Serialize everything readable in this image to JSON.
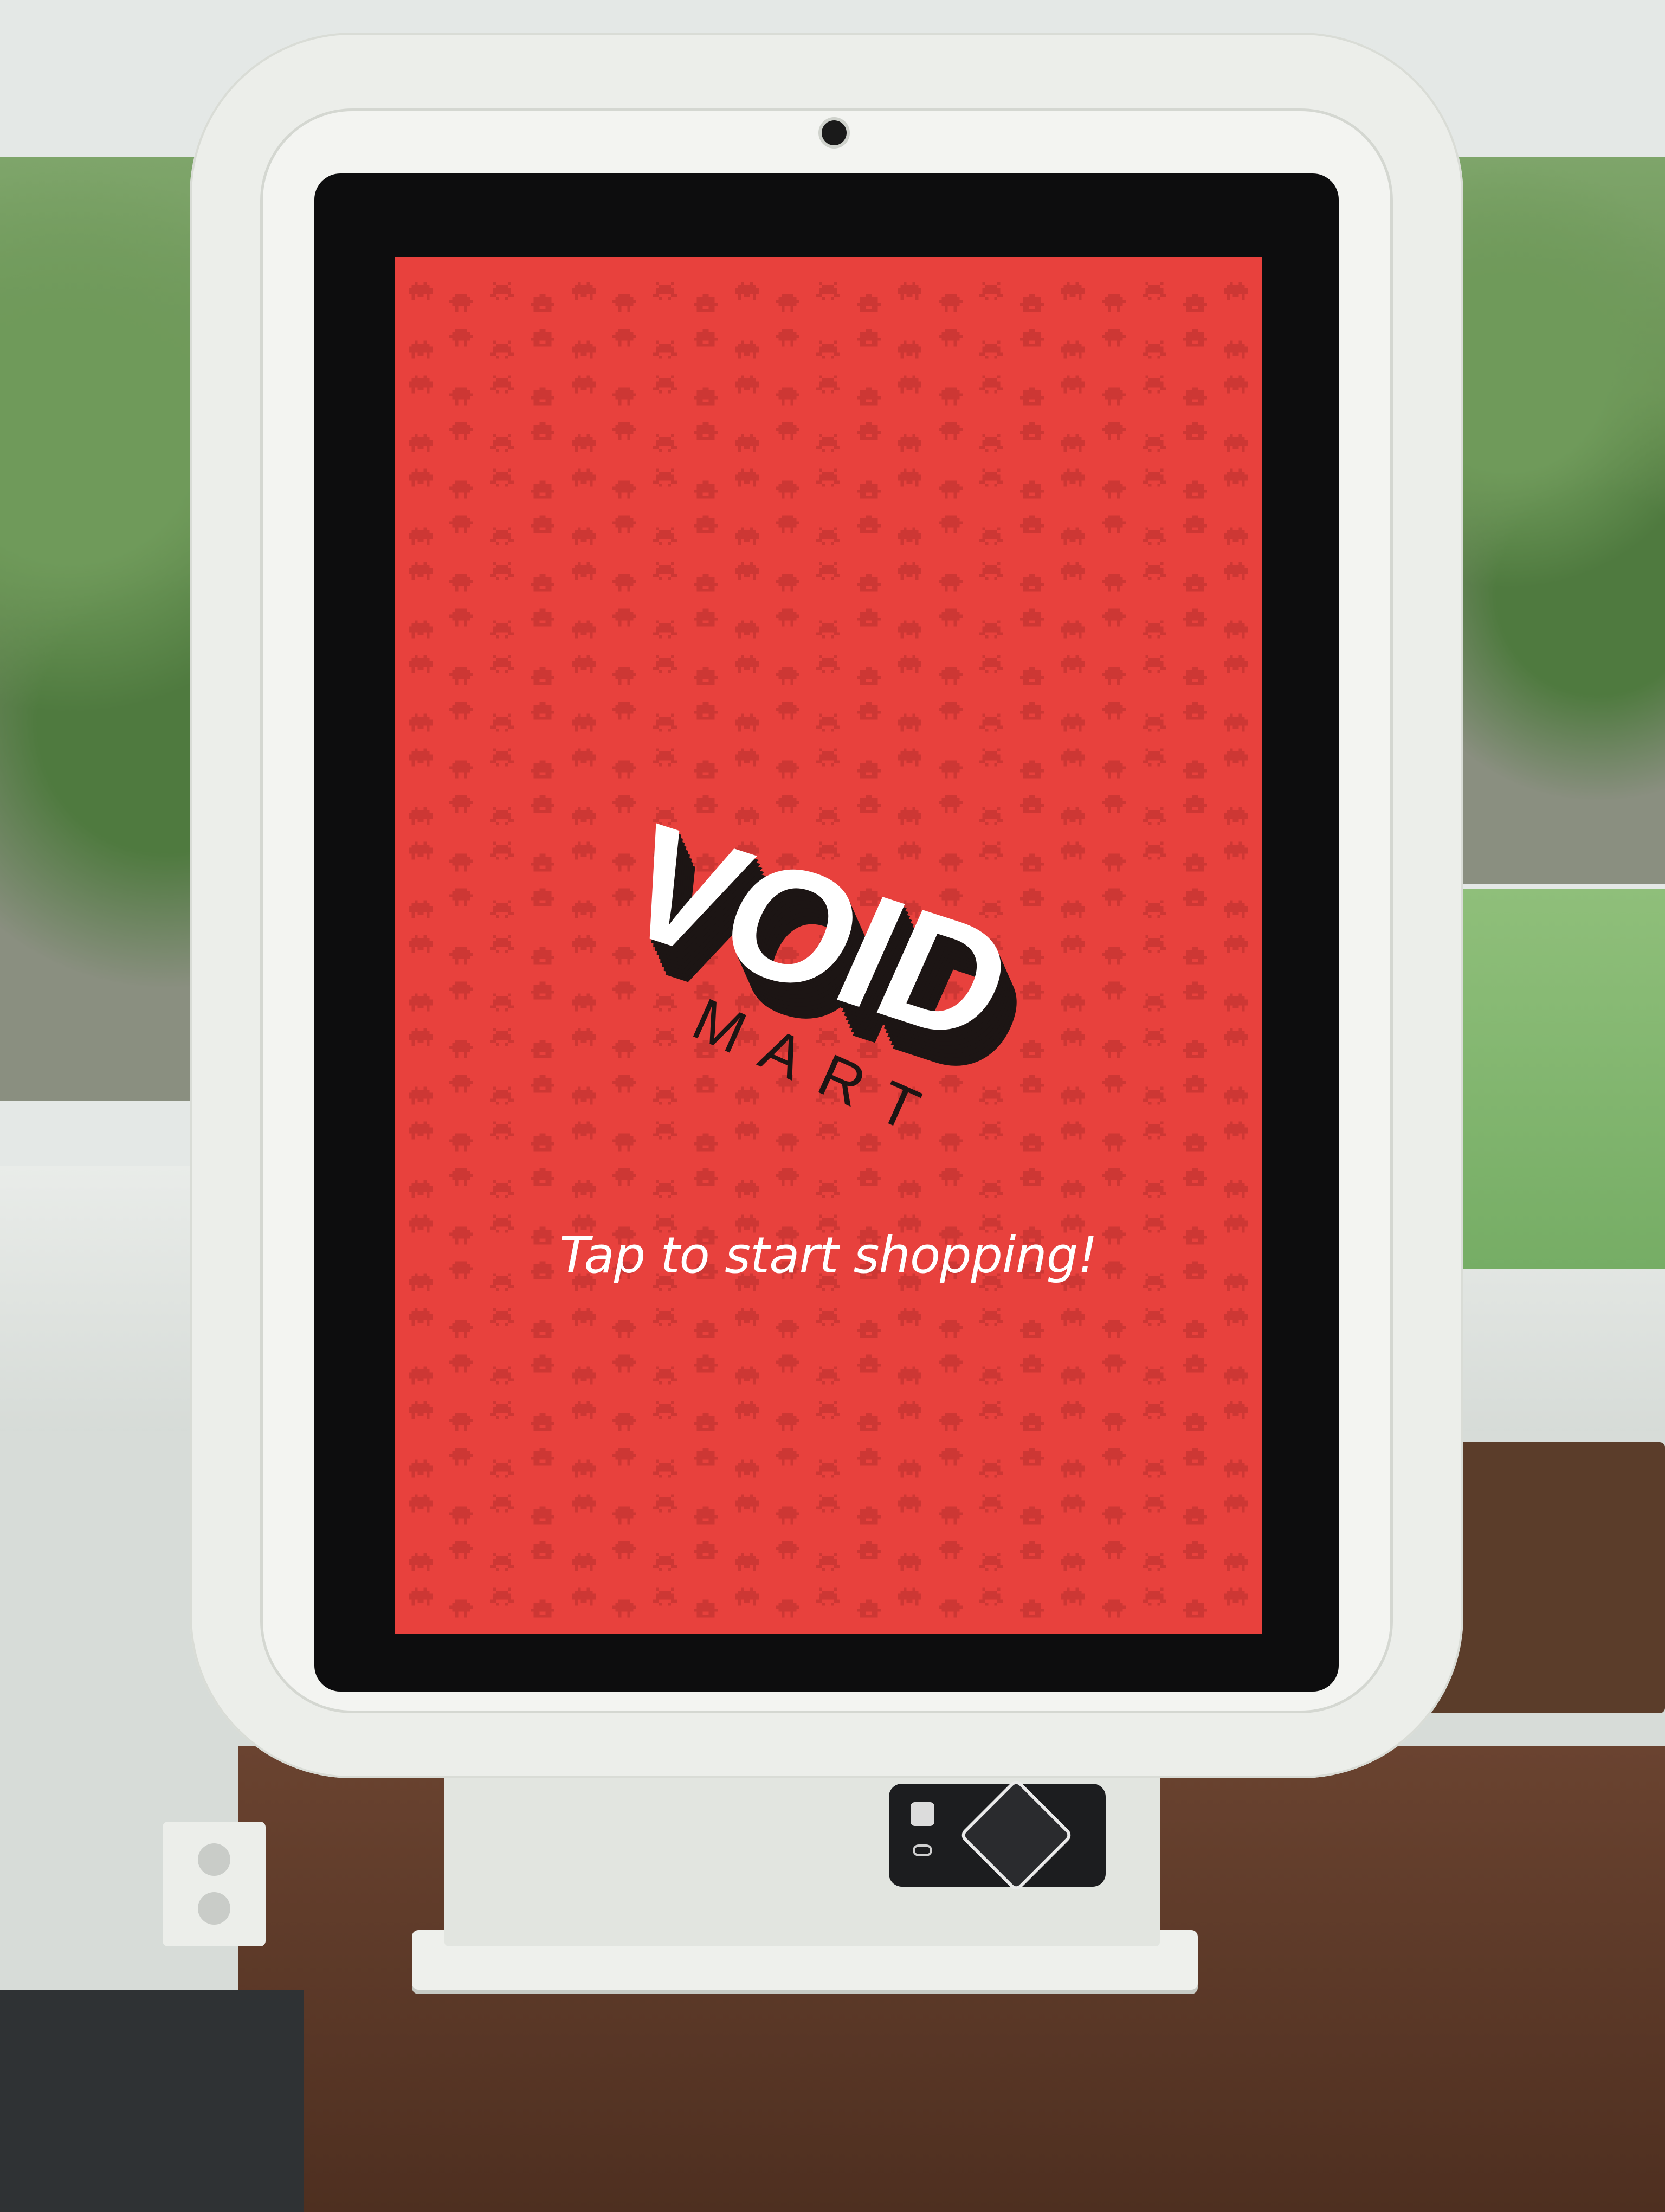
{
  "screen": {
    "background_color": "#e8413d",
    "pattern_icon": "space-invader-icon",
    "logo": {
      "primary_text": "VOID",
      "secondary_text": "MART"
    },
    "tagline": "Tap to start shopping!"
  },
  "device": {
    "type": "self-checkout kiosk",
    "peripherals": [
      "camera",
      "card-reader",
      "status-light"
    ]
  }
}
